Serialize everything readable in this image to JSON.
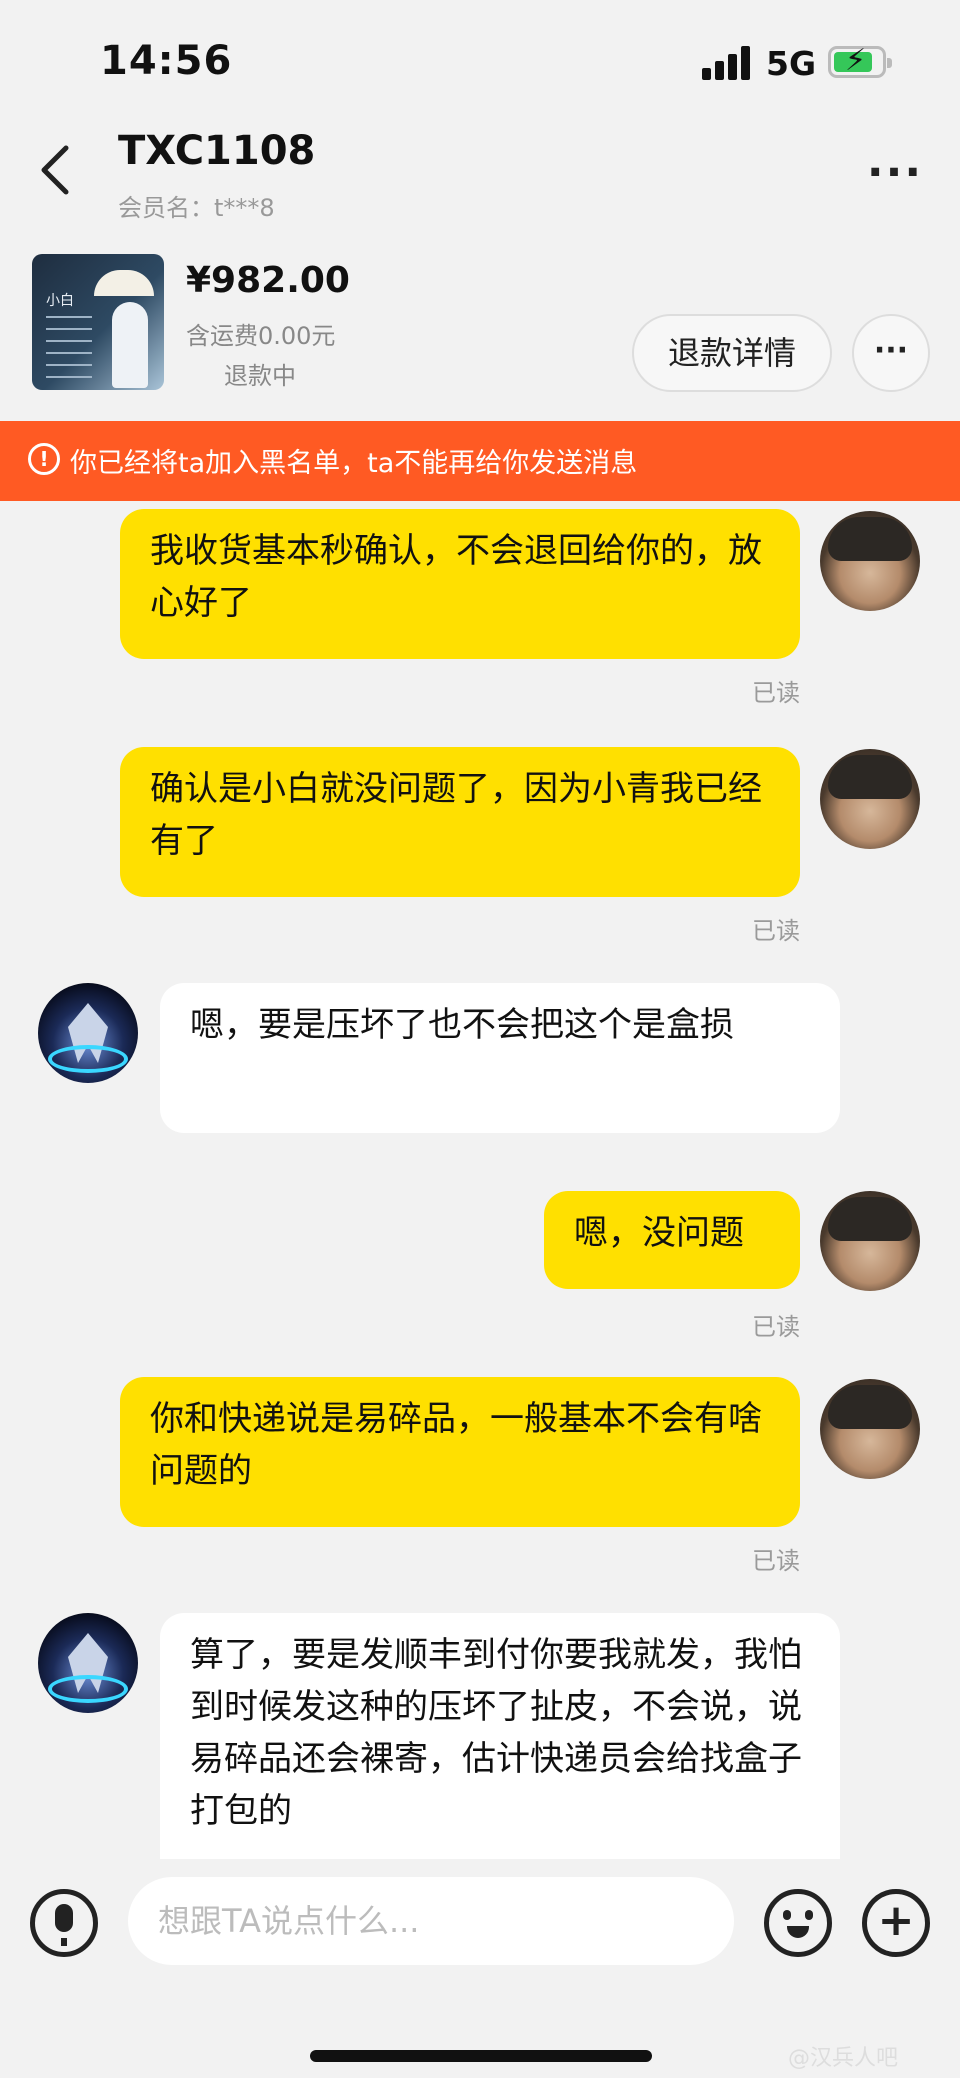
{
  "status_bar": {
    "time": "14:56",
    "network": "5G"
  },
  "header": {
    "title": "TXC1108",
    "subtitle": "会员名：t***8",
    "more_label": "···"
  },
  "order": {
    "price": "¥982.00",
    "shipping": "含运费0.00元",
    "status": "退款中",
    "refund_button": "退款详情",
    "more_label": "···",
    "thumb_title": "小白"
  },
  "banner": {
    "icon_text": "!",
    "text": "你已经将ta加入黑名单，ta不能再给你发送消息"
  },
  "messages": [
    {
      "side": "me",
      "text": "我收货基本秒确认，不会退回给你的，放心好了",
      "read": "已读"
    },
    {
      "side": "me",
      "text": "确认是小白就没问题了，因为小青我已经有了",
      "read": "已读"
    },
    {
      "side": "them",
      "text": "嗯，要是压坏了也不会把这个是盒损"
    },
    {
      "side": "me",
      "text": "嗯，没问题",
      "read": "已读"
    },
    {
      "side": "me",
      "text": "你和快递说是易碎品，一般基本不会有啥问题的",
      "read": "已读"
    },
    {
      "side": "them",
      "text": "算了，要是发顺丰到付你要我就发，我怕到时候发这种的压坏了扯皮，不会说，说易碎品还会裸寄，估计快递员会给找盒子打包的"
    }
  ],
  "input": {
    "placeholder": "想跟TA说点什么..."
  },
  "watermark": "@汉兵人吧"
}
